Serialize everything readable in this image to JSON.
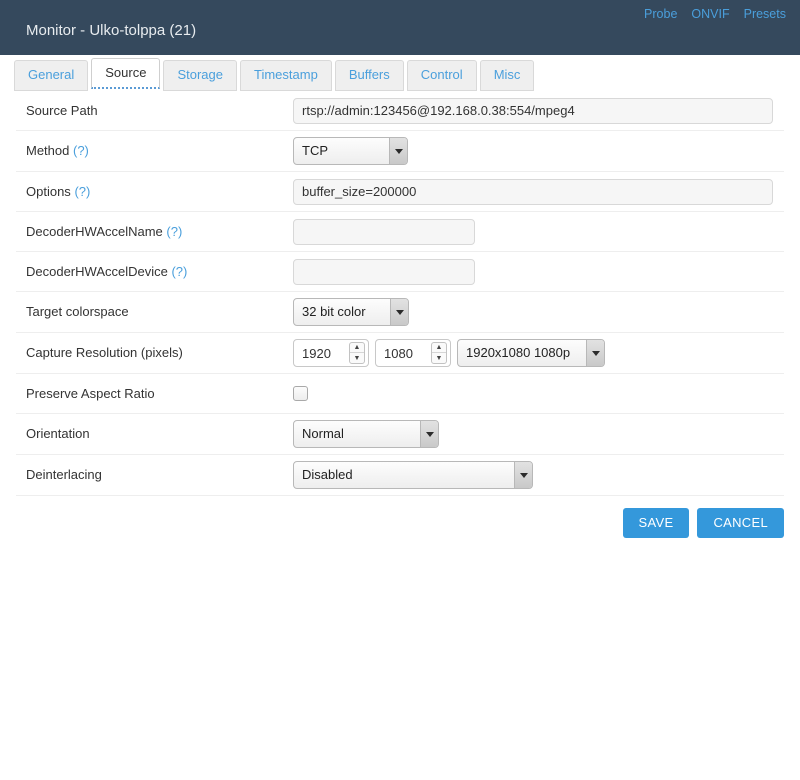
{
  "header": {
    "title": "Monitor - Ulko-tolppa (21)",
    "links": [
      {
        "label": "Probe",
        "name": "probe-link"
      },
      {
        "label": "ONVIF",
        "name": "onvif-link"
      },
      {
        "label": "Presets",
        "name": "presets-link"
      }
    ],
    "background_color": "#35495d",
    "link_color": "#4a9fdc"
  },
  "tabs": [
    {
      "label": "General",
      "active": false
    },
    {
      "label": "Source",
      "active": true
    },
    {
      "label": "Storage",
      "active": false
    },
    {
      "label": "Timestamp",
      "active": false
    },
    {
      "label": "Buffers",
      "active": false
    },
    {
      "label": "Control",
      "active": false
    },
    {
      "label": "Misc",
      "active": false
    }
  ],
  "form": {
    "source_path": {
      "label": "Source Path",
      "value": "rtsp://admin:123456@192.168.0.38:554/mpeg4",
      "placeholder": ""
    },
    "method": {
      "label": "Method",
      "help": "(?)",
      "value": "TCP"
    },
    "options": {
      "label": "Options",
      "help": "(?)",
      "value": "buffer_size=200000",
      "placeholder": ""
    },
    "decoder_hwaccel_name": {
      "label": "DecoderHWAccelName",
      "help": "(?)",
      "value": "",
      "placeholder": ""
    },
    "decoder_hwaccel_device": {
      "label": "DecoderHWAccelDevice",
      "help": "(?)",
      "value": "",
      "placeholder": ""
    },
    "target_colorspace": {
      "label": "Target colorspace",
      "value": "32 bit color"
    },
    "capture_resolution": {
      "label": "Capture Resolution (pixels)",
      "width": "1920",
      "height": "1080",
      "preset": "1920x1080 1080p"
    },
    "preserve_aspect_ratio": {
      "label": "Preserve Aspect Ratio",
      "checked": false
    },
    "orientation": {
      "label": "Orientation",
      "value": "Normal"
    },
    "deinterlacing": {
      "label": "Deinterlacing",
      "value": "Disabled"
    }
  },
  "buttons": {
    "save": "SAVE",
    "cancel": "CANCEL",
    "accent_color": "#3498db"
  },
  "icons": {
    "spin_up": "▲",
    "spin_down": "▼"
  }
}
